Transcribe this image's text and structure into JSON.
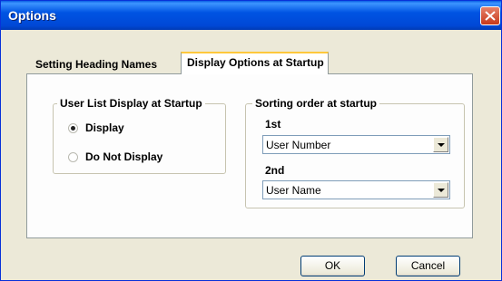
{
  "window": {
    "title": "Options"
  },
  "tabs": [
    {
      "label": "Setting Heading Names",
      "selected": false
    },
    {
      "label": "Display Options at Startup",
      "selected": true
    }
  ],
  "user_list_group": {
    "legend": "User List Display at Startup",
    "options": [
      {
        "label": "Display",
        "selected": true
      },
      {
        "label": "Do Not Display",
        "selected": false
      }
    ]
  },
  "sorting_group": {
    "legend": "Sorting order at startup",
    "first": {
      "label": "1st",
      "value": "User Number"
    },
    "second": {
      "label": "2nd",
      "value": "User Name"
    }
  },
  "buttons": {
    "ok": "OK",
    "cancel": "Cancel"
  },
  "icons": {
    "close": "close-icon",
    "dropdown": "chevron-down-icon",
    "radio": "radio-icon"
  },
  "colors": {
    "title_bar": "#0054e3",
    "dialog_bg": "#ece9d8",
    "close_button": "#c8391a",
    "tab_highlight": "#ffc83c"
  }
}
